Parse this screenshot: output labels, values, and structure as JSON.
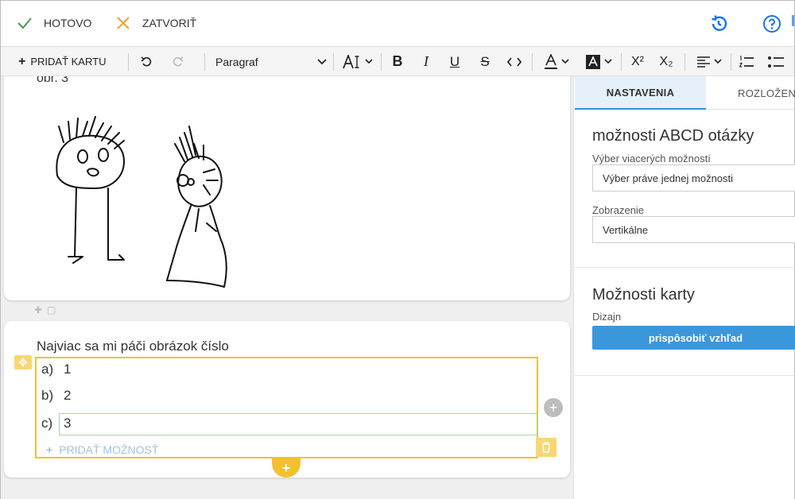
{
  "topbar": {
    "done_label": "HOTOVO",
    "close_label": "ZATVORIŤ",
    "colors": {
      "done": "#2e7d32",
      "close": "#f0a030",
      "accent": "#1a73e8"
    }
  },
  "toolbar": {
    "add_card_label": "PRIDAŤ KARTU",
    "paragraph_value": "Paragraf",
    "superscript_label": "X²",
    "subscript_label": "X₂"
  },
  "canvas": {
    "card1_caption": "obr. 3",
    "question": "Najviac sa mi páči obrázok číslo",
    "options": [
      {
        "label": "a)",
        "value": "1"
      },
      {
        "label": "b)",
        "value": "2"
      },
      {
        "label": "c)",
        "value": "3"
      }
    ],
    "add_option_label": "PRIDAŤ MOŽNOSŤ",
    "accent_color": "#f2c12e"
  },
  "panel": {
    "tab_settings": "NASTAVENIA",
    "tab_layout": "ROZLOŽEN",
    "section1_title": "možnosti ABCD otázky",
    "multi_choice_label": "Výber viacerých možností",
    "multi_choice_value": "Výber práve jednej možnosti",
    "display_label": "Zobrazenie",
    "display_value": "Vertikálne",
    "section2_title": "Možnosti karty",
    "design_label": "Dizajn",
    "design_button": "prispôsobiť vzhľad",
    "button_color": "#3b97dc"
  }
}
